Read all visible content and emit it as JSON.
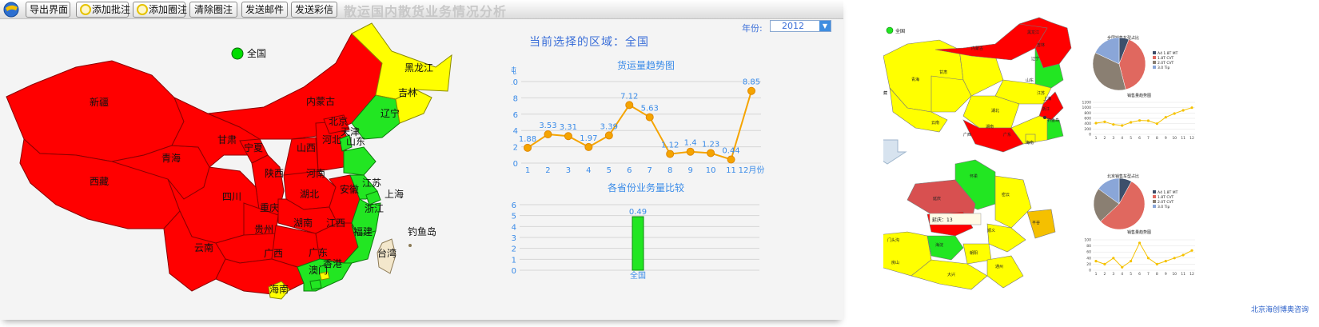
{
  "toolbar": {
    "export": "导出界面",
    "add_note": "添加批注",
    "add_circle": "添加圈注",
    "clear_circle": "清除圈注",
    "send_email": "发送邮件",
    "send_mms": "发送彩信",
    "title": "散运国内散货业务情况分析"
  },
  "filter": {
    "year_label": "年份:",
    "year_value": "2012"
  },
  "region_text": "当前选择的区域：全国",
  "map": {
    "legend": "全国",
    "colors": {
      "red": "#ff0000",
      "green": "#22e622",
      "yellow": "#ffff00"
    },
    "provinces": [
      "新疆",
      "西藏",
      "青海",
      "甘肃",
      "内蒙古",
      "黑龙江",
      "吉林",
      "辽宁",
      "北京",
      "天津",
      "河北",
      "山西",
      "宁夏",
      "陕西",
      "河南",
      "山东",
      "江苏",
      "上海",
      "安徽",
      "湖北",
      "四川",
      "重庆",
      "浙江",
      "湖南",
      "江西",
      "贵州",
      "福建",
      "云南",
      "广西",
      "广东",
      "香港",
      "澳门",
      "台湾",
      "海南",
      "钓鱼岛"
    ]
  },
  "chart_data": [
    {
      "type": "line",
      "title": "货运量趋势图",
      "ylabel": "万吨",
      "categories": [
        "1",
        "2",
        "3",
        "4",
        "5",
        "6",
        "7",
        "8",
        "9",
        "10",
        "11",
        "12月份"
      ],
      "values": [
        1.88,
        3.53,
        3.31,
        1.97,
        3.39,
        7.12,
        5.63,
        1.12,
        1.4,
        1.23,
        0.44,
        8.85
      ],
      "yticks": [
        "0",
        "2",
        "4",
        "6",
        "8",
        "10"
      ],
      "ylim": [
        0,
        10
      ],
      "color": "#f5a400"
    },
    {
      "type": "bar",
      "title": "各省份业务量比较",
      "categories": [
        "全国"
      ],
      "values": [
        0.49
      ],
      "yticks": [
        "0",
        "0.1",
        "0.2",
        "0.3",
        "0.4",
        "0.5",
        "0.6"
      ],
      "ylim": [
        0,
        0.6
      ],
      "color": "#22e622"
    },
    {
      "type": "pie",
      "title": "全国销售车型占比",
      "legend": [
        "A4 1.8T MT",
        "1.8T CVT",
        "2.0T CVT",
        "3.0 Tip"
      ],
      "colors": [
        "#3d4f6b",
        "#e0685f",
        "#8a7f72",
        "#8aa6d8"
      ],
      "values": [
        0.06,
        0.4,
        0.36,
        0.18
      ]
    },
    {
      "type": "line",
      "title": "销售量趋势图",
      "categories": [
        "1",
        "2",
        "3",
        "4",
        "5",
        "6",
        "7",
        "8",
        "9",
        "10",
        "11",
        "12"
      ],
      "values": [
        420,
        470,
        370,
        330,
        450,
        520,
        510,
        400,
        640,
        780,
        900,
        1000
      ],
      "yticks": [
        "0",
        "200",
        "400",
        "600",
        "800",
        "1000",
        "1200"
      ],
      "ylim": [
        0,
        1200
      ],
      "color": "#f5c200"
    },
    {
      "type": "pie",
      "title": "北京销售车型占比",
      "legend": [
        "A4 1.8T MT",
        "1.8T CVT",
        "2.0T CVT",
        "3.0 Tip"
      ],
      "colors": [
        "#3d4f6b",
        "#e0685f",
        "#8a7f72",
        "#8aa6d8"
      ],
      "values": [
        0.08,
        0.55,
        0.22,
        0.15
      ]
    },
    {
      "type": "line",
      "title": "销售量趋势图",
      "categories": [
        "1",
        "2",
        "3",
        "4",
        "5",
        "6",
        "7",
        "8",
        "9",
        "10",
        "11",
        "12"
      ],
      "values": [
        30,
        20,
        40,
        10,
        30,
        90,
        40,
        20,
        30,
        40,
        50,
        65
      ],
      "yticks": [
        "0",
        "20",
        "40",
        "60",
        "80",
        "100"
      ],
      "ylim": [
        0,
        100
      ],
      "color": "#f5c200"
    }
  ],
  "right_panel": {
    "legend_top": "全国",
    "legend_bottom": [
      "北京",
      "全国"
    ],
    "tooltip": "延庆：13",
    "brand": "北京海创博奥咨询",
    "top_map_labels": [
      "新疆",
      "西藏",
      "青海",
      "甘肃",
      "内蒙古",
      "黑龙江",
      "吉林",
      "辽宁",
      "山东",
      "江苏",
      "上海",
      "浙江",
      "湖北",
      "湖南",
      "广东",
      "广西",
      "云南",
      "海南",
      "钓鱼岛"
    ],
    "bottom_map_labels": [
      "延庆",
      "怀柔",
      "密云",
      "平谷",
      "顺义",
      "门头沟",
      "海淀",
      "朝阳",
      "通州",
      "房山",
      "大兴"
    ]
  }
}
